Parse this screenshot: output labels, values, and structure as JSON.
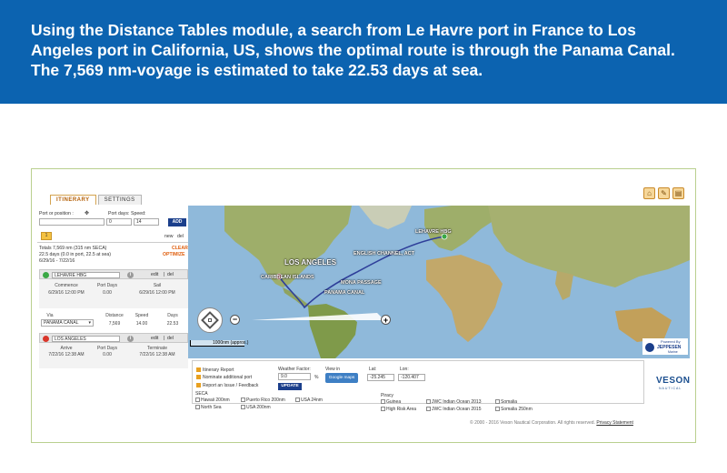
{
  "banner": {
    "text": "Using the Distance Tables module, a search from Le Havre port in France to Los Angeles port in California, US, shows the optimal route is through the Panama Canal. The 7,569 nm-voyage is estimated to take 22.53 days at sea."
  },
  "tabs": [
    {
      "label": "ITINERARY",
      "active": true
    },
    {
      "label": "SETTINGS",
      "active": false
    }
  ],
  "top_icons": [
    "home-icon",
    "edit-icon",
    "print-icon"
  ],
  "search": {
    "port_label": "Port or position :",
    "port_days_label": "Port days:",
    "speed_label": "Speed:",
    "port_days_value": "0",
    "speed_value": "14",
    "add_label": "ADD",
    "step_number": "1",
    "new_label": "new",
    "del_label": "del"
  },
  "totals": {
    "line1": "Totals 7,569 nm (315 nm SECA)",
    "line2": "22.5 days (0.0 in port, 22.5 at sea)",
    "line3": "6/29/16 - 7/22/16",
    "clear": "CLEAR",
    "optimize": "OPTIMIZE"
  },
  "origin": {
    "name": "LEHAVRE HBG",
    "edit": "edit",
    "del": "del",
    "headers": [
      "Commence",
      "Port Days",
      "Sail"
    ],
    "values": [
      "6/29/16 12:00 PM",
      "0.00",
      "6/29/16 12:00 PM"
    ],
    "dot_color": "#3aa845"
  },
  "leg": {
    "headers": [
      "Via",
      "Distance",
      "Speed",
      "Days"
    ],
    "via": "PANAMA CANAL",
    "distance": "7,569",
    "speed": "14.00",
    "days": "22.53"
  },
  "destination": {
    "name": "LOS ANGELES",
    "edit": "edit",
    "del": "del",
    "headers": [
      "Arrive",
      "Port Days",
      "Terminate"
    ],
    "values": [
      "7/22/16 12:38 AM",
      "0.00",
      "7/22/16 12:38 AM"
    ],
    "dot_color": "#d9362b"
  },
  "map": {
    "labels": {
      "los_angeles": "LOS ANGELES",
      "le_havre": "LEHAVRE HBG",
      "caribbean": "CARIBBEAN ISLANDS",
      "english_channel": "ENGLISH CHANNEL, ACT",
      "mona": "MONA PASSAGE",
      "panama": "PANAMA CANAL"
    },
    "scale": "1000nm (approx.)",
    "powered_by": "Powered By",
    "jeppesen": "JEPPESEN",
    "jeppesen_sub": "Marine",
    "colors": {
      "ocean": "#8fb9da",
      "land": "#9eae6a",
      "route": "#2f3f9a"
    }
  },
  "bottom": {
    "itinerary_report": "Itinerary Report",
    "nominate": "Nominate additional port",
    "report_issue": "Report an Issue / Feedback",
    "weather_label": "Weather Factor:",
    "weather_value": "9.0",
    "percent": "%",
    "update": "UPDATE",
    "view_in": "View in",
    "google_maps": "Google maps",
    "lat_label": "Lat:",
    "lat_value": "-25.245",
    "lon_label": "Lon:",
    "lon_value": "-120.407",
    "seca_label": "SECA",
    "seca_items": [
      "Hawaii 200nm",
      "Puerto Rico 200nm",
      "USA 24nm",
      "North Sea",
      "USA 200nm"
    ],
    "piracy_label": "Piracy",
    "piracy_items": [
      "Guinea",
      "JWC Indian Ocean 2013",
      "Somalia",
      "High Risk Area",
      "JWC Indian Ocean 2015",
      "Somalia 250nm"
    ],
    "brand": "VESON",
    "brand_sub": "NAUTICAL",
    "copyright": "© 2000 - 2016 Veson Nautical Corporation. All rights reserved.",
    "privacy": "Privacy Statement"
  }
}
